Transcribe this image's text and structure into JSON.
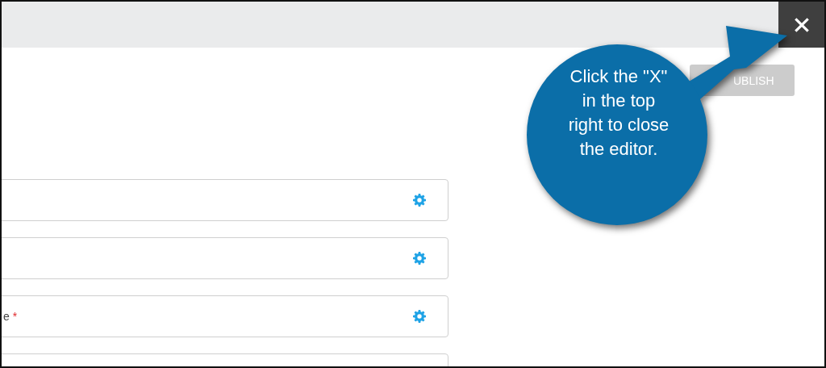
{
  "publish_button": {
    "label": "UBLISH",
    "disabled": true
  },
  "fields": [
    {
      "kind": "text"
    },
    {
      "kind": "text"
    },
    {
      "kind": "text",
      "label": "e",
      "required_mark": "*"
    },
    {
      "kind": "cut_off"
    }
  ],
  "callout": {
    "text": "Click the \"X\" in the top right to close the editor."
  }
}
